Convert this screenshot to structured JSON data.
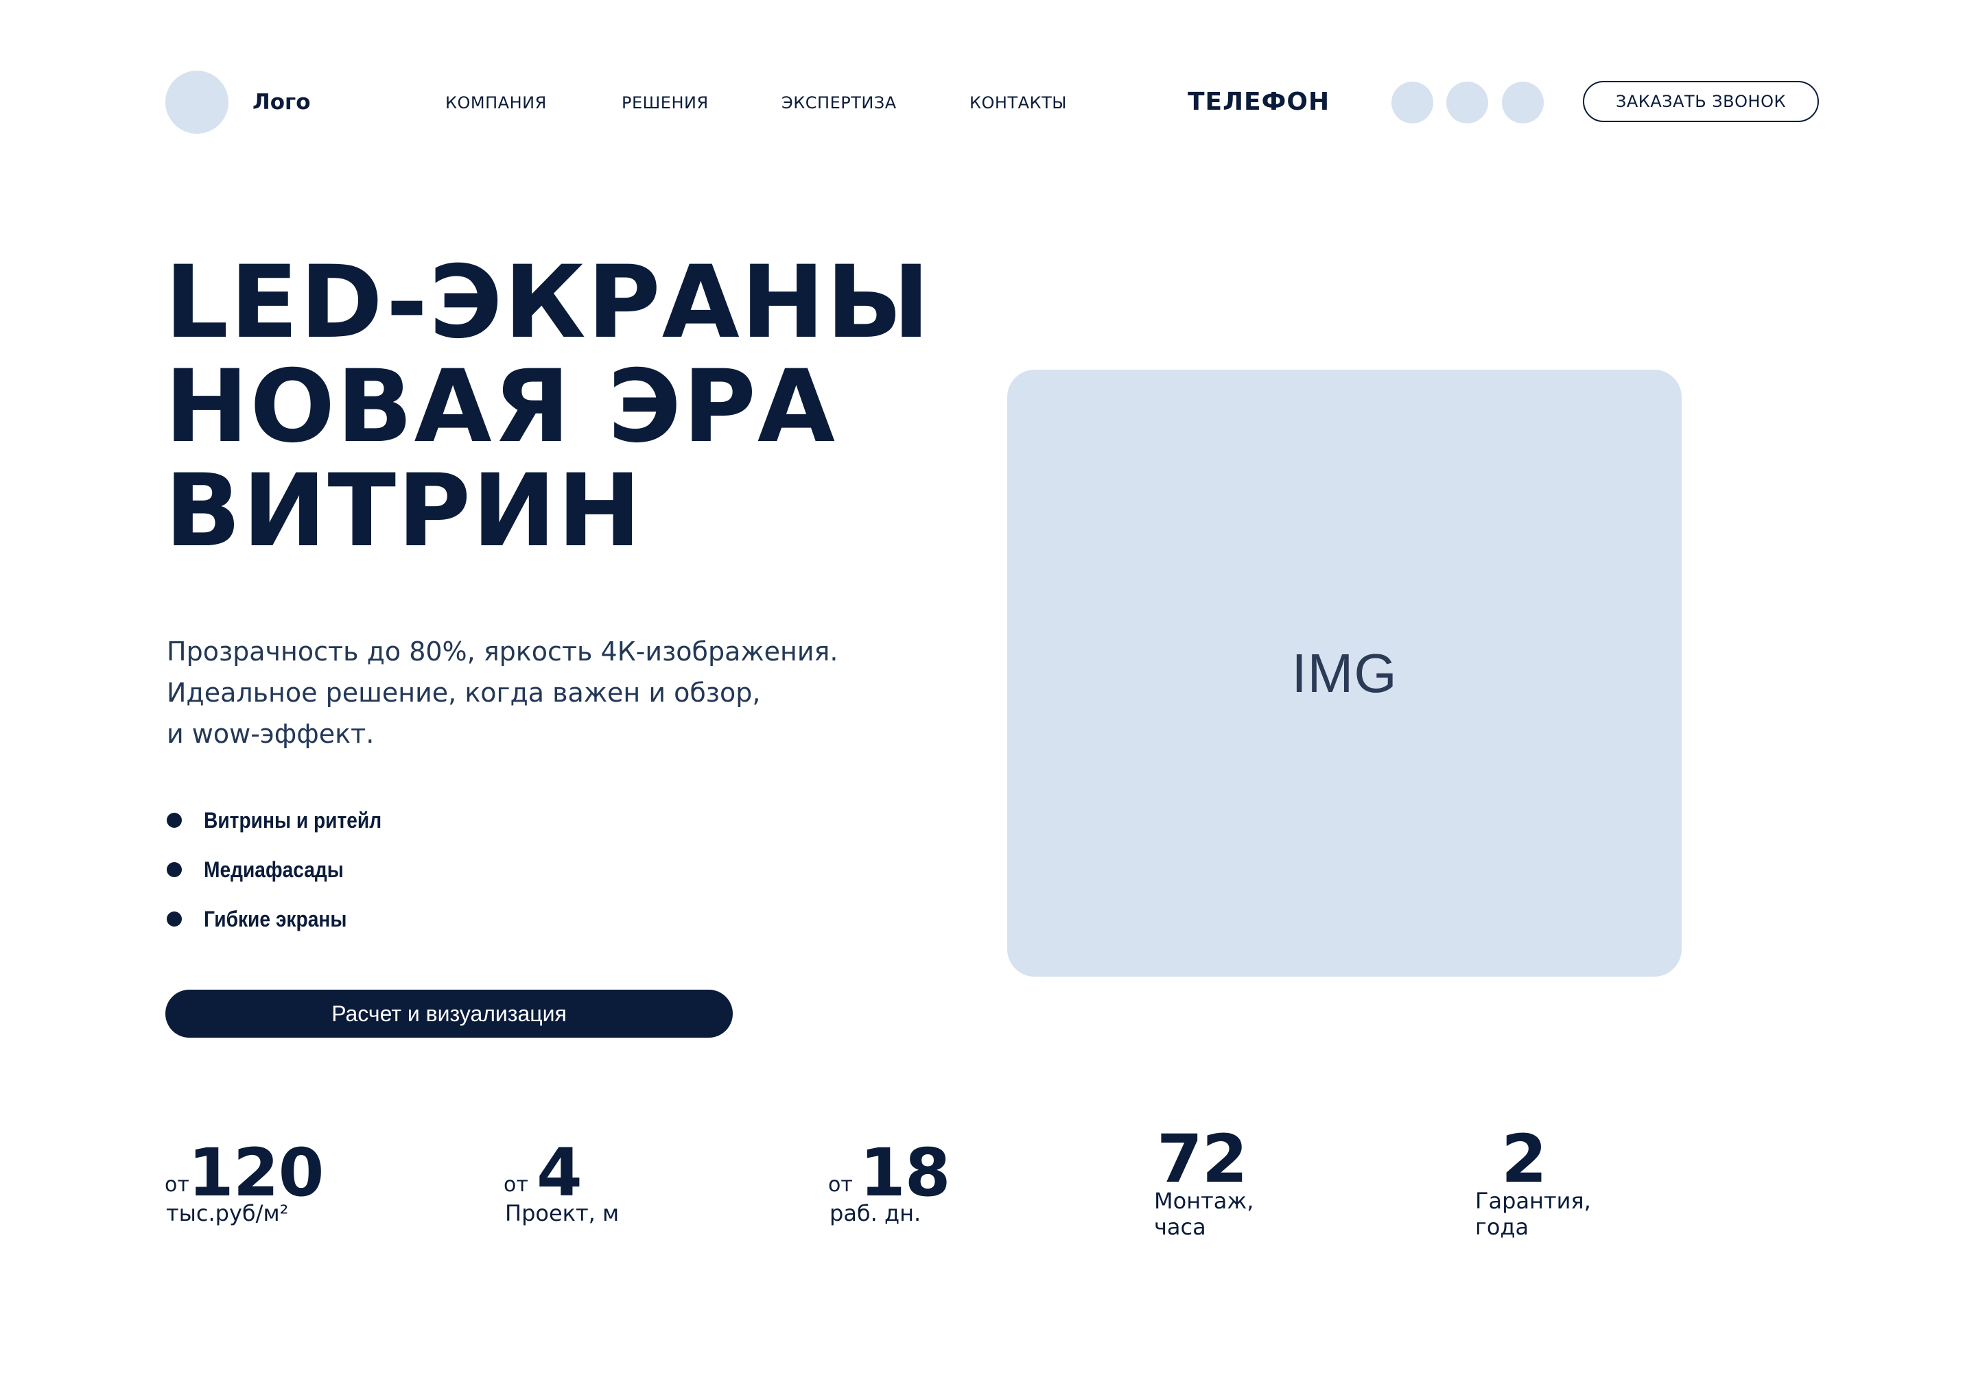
{
  "header": {
    "logo_text": "Лого",
    "nav": [
      "КОМПАНИЯ",
      "РЕШЕНИЯ",
      "ЭКСПЕРТИЗА",
      "КОНТАКТЫ"
    ],
    "phone": "ТЕЛЕФОН",
    "callback_label": "ЗАКАЗАТЬ ЗВОНОК"
  },
  "hero": {
    "title_lines": [
      "LED-ЭКРАНЫ",
      "НОВАЯ ЭРА",
      "ВИТРИН"
    ],
    "subtitle_lines": [
      "Прозрачность до 80%, яркость 4К-изображения.",
      "Идеальное решение, когда важен и обзор,",
      "и wow-эффект."
    ],
    "features": [
      "Витрины и ритейл",
      "Медиафасады",
      "Гибкие экраны"
    ],
    "cta_label": "Расчет и визуализация",
    "image_placeholder": "IMG"
  },
  "stats": [
    {
      "prefix": "от",
      "value": "120",
      "label": "тыс.руб/м²"
    },
    {
      "prefix": "от",
      "value": "4",
      "label": "Проект, м"
    },
    {
      "prefix": "от",
      "value": "18",
      "label": "раб. дн."
    },
    {
      "value": "72",
      "label_lines": [
        "Монтаж,",
        "часа"
      ]
    },
    {
      "value": "2",
      "label_lines": [
        "Гарантия,",
        "года"
      ]
    }
  ],
  "colors": {
    "primary": "#0b1c3a",
    "placeholder": "#d7e2f0",
    "background": "#ffffff"
  }
}
